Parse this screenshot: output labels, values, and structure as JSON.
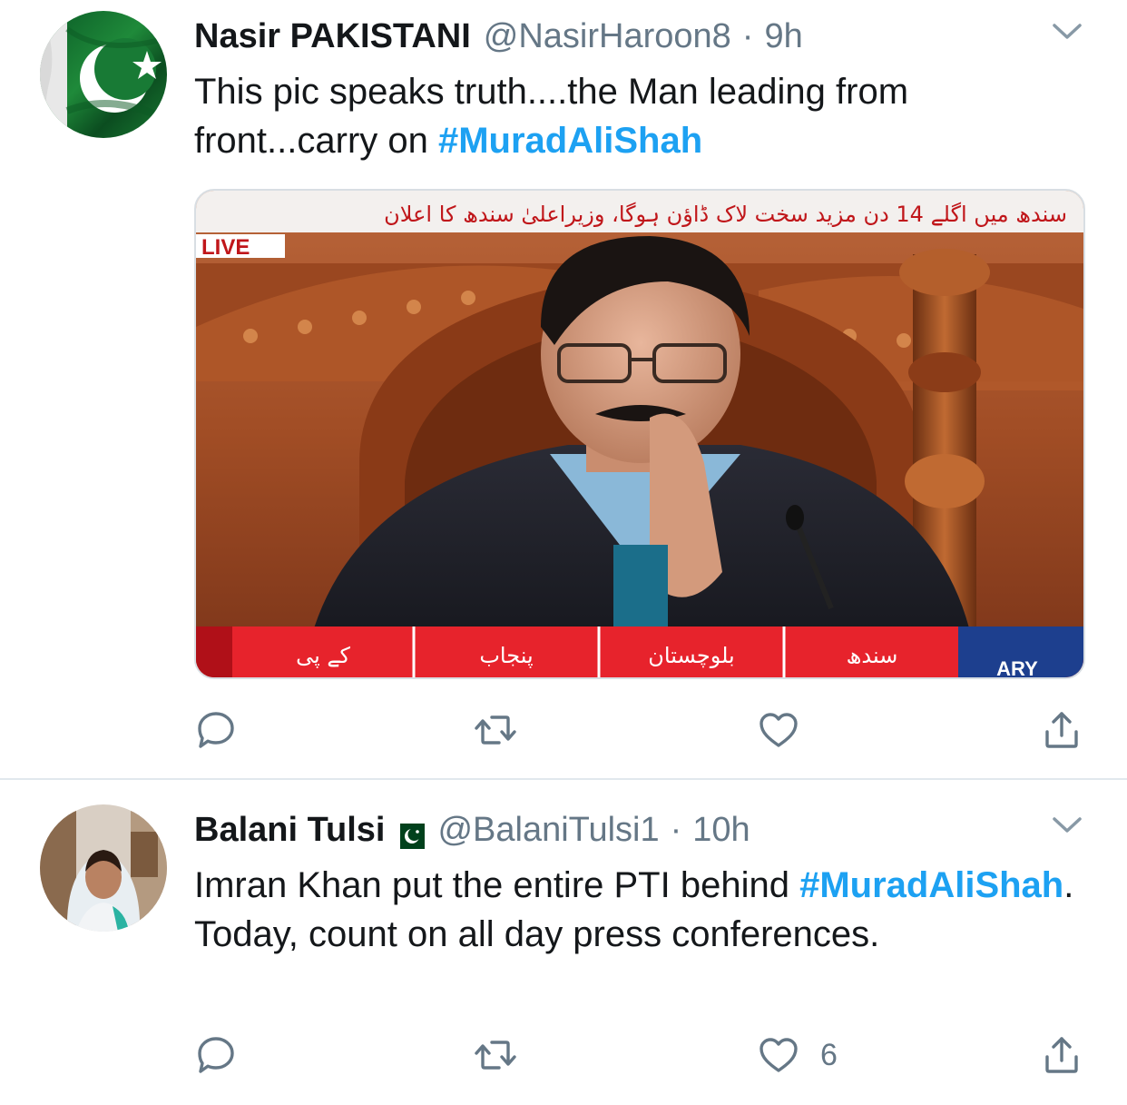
{
  "tweets": [
    {
      "display_name": "Nasir PAKISTANI",
      "handle": "@NasirHaroon8",
      "separator": "·",
      "time": "9h",
      "text_prefix": "This pic speaks truth....the Man leading from front...carry on ",
      "hashtag": "#MuradAliShah",
      "text_suffix": "",
      "media": {
        "ticker_top": "سندھ میں اگلے 14 دن مزید سخت لاک ڈاؤن ہوگا، وزیراعلیٰ سندھ کا اعلان",
        "live_label": "LIVE",
        "ticker_bottom": [
          "کے پی",
          "پنجاب",
          "بلوچستان",
          "سندھ"
        ],
        "channel": "ARY"
      },
      "actions": {
        "reply_count": "",
        "retweet_count": "",
        "like_count": ""
      }
    },
    {
      "display_name": "Balani Tulsi",
      "handle": "@BalaniTulsi1",
      "separator": "·",
      "time": "10h",
      "text_prefix": "Imran Khan put the entire PTI behind ",
      "hashtag": "#MuradAliShah",
      "text_suffix": ". Today, count on all day press conferences.",
      "actions": {
        "reply_count": "",
        "retweet_count": "",
        "like_count": "6"
      }
    }
  ],
  "colors": {
    "link": "#1da1f2",
    "secondary": "#657786",
    "divider": "#e1e8ed",
    "pakistan_green": "#01411c"
  },
  "icons": {
    "reply": "reply-icon",
    "retweet": "retweet-icon",
    "like": "heart-icon",
    "share": "share-icon",
    "more": "chevron-down-icon"
  }
}
